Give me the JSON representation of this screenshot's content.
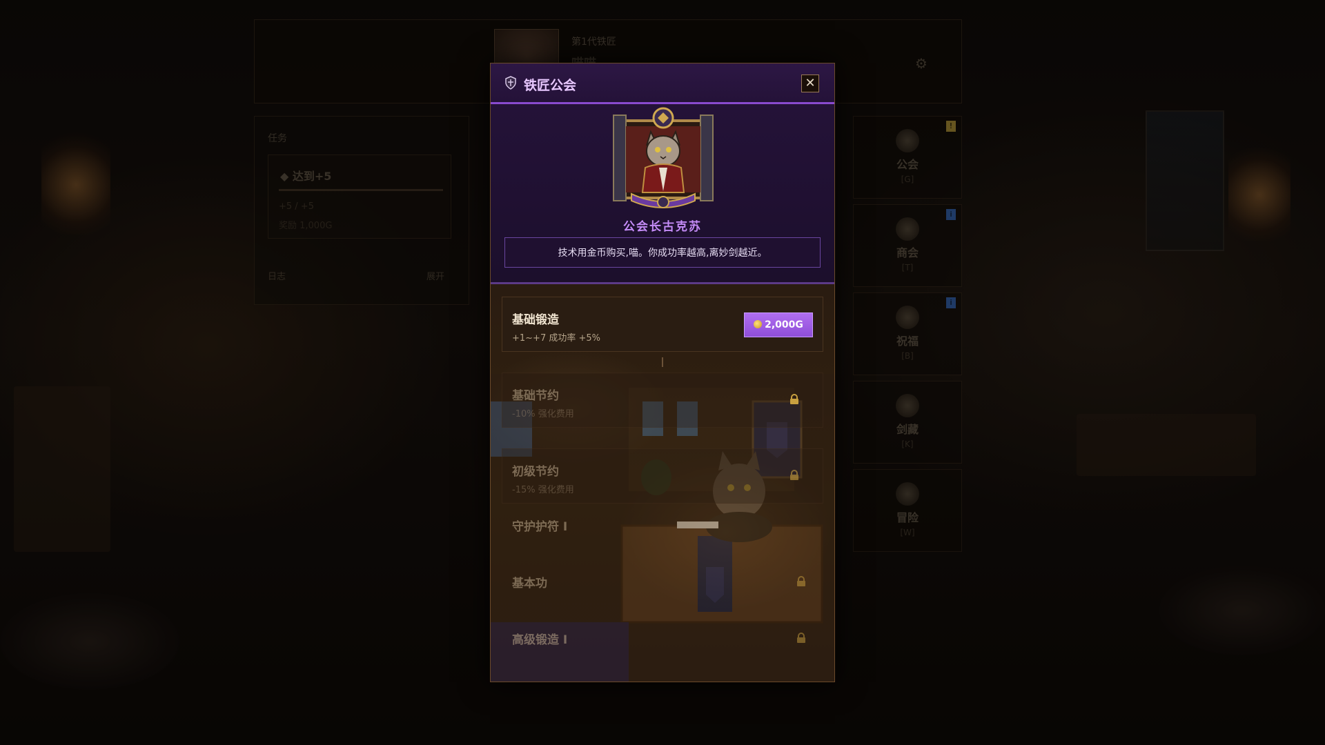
{
  "background_hud": {
    "player_label": "第1代铁匠",
    "player_name": "喵喵",
    "quest": {
      "title": "任务",
      "goal": "达到+5",
      "line1": "+5 / +5",
      "line2": "奖励 1,000G",
      "footer_left": "日志",
      "footer_right": "展开"
    },
    "side_buttons": [
      {
        "label": "公会",
        "key": "[G]",
        "icon": "guild-shield-icon"
      },
      {
        "label": "商会",
        "key": "[T]",
        "icon": "merchant-icon"
      },
      {
        "label": "祝福",
        "key": "[B]",
        "icon": "blessing-icon"
      },
      {
        "label": "剑藏",
        "key": "[K]",
        "icon": "collection-icon"
      },
      {
        "label": "冒险",
        "key": "[W]",
        "icon": "adventure-icon"
      }
    ]
  },
  "modal": {
    "title": "铁匠公会",
    "close_label": "✕",
    "npc_name": "公会长古克苏",
    "npc_quote": "技术用金币购买,喵。你成功率越高,离妙剑越近。",
    "skills": [
      {
        "name": "基础锻造",
        "desc": "+1~+7 成功率 +5%",
        "price": "2,000G",
        "locked": false
      },
      {
        "name": "基础节约",
        "desc": "-10% 强化费用",
        "locked": true
      },
      {
        "name": "初级节约",
        "desc": "-15% 强化费用",
        "locked": true
      },
      {
        "name": "守护护符 I",
        "desc": "",
        "locked": true
      },
      {
        "name": "基本功",
        "desc": "",
        "locked": true
      },
      {
        "name": "高级锻造 I",
        "desc": "",
        "locked": true
      }
    ]
  },
  "colors": {
    "accent_purple": "#8a4bd0",
    "npc_name": "#c58cf8",
    "buy_button": "#b06ef0",
    "panel_brown": "#2a1d12"
  }
}
